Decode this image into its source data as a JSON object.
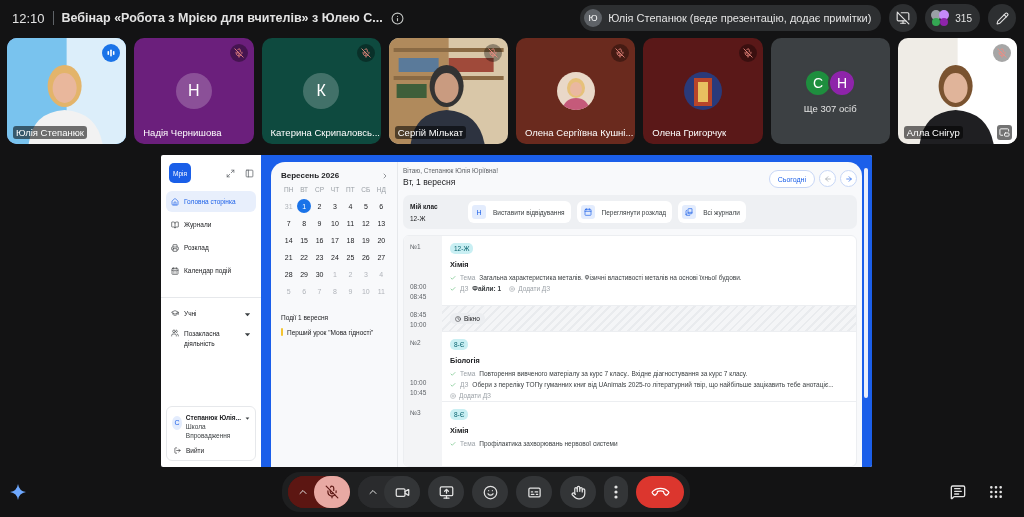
{
  "meeting": {
    "time": "12:10",
    "title": "Вебінар «Робота з Мрією для вчителів» з Юлею С..."
  },
  "presenter": {
    "initial": "Ю",
    "label": "Юлія Степанюк (веде презентацію, додає примітки)"
  },
  "participant_count": "315",
  "tiles": [
    {
      "kind": "video",
      "name": "Юлія Степанюк",
      "muted": false,
      "speaking": true
    },
    {
      "kind": "initial",
      "name": "Надія Чернишова",
      "initial": "Н",
      "muted": true,
      "speaking": false,
      "color": "#6b1f7c"
    },
    {
      "kind": "initial",
      "name": "Катерина Скрипаловсь...",
      "initial": "К",
      "muted": true,
      "speaking": false,
      "color": "#0e4a3f"
    },
    {
      "kind": "video",
      "name": "Сергій Мількат",
      "muted": true,
      "speaking": false
    },
    {
      "name": "Олена Сергіївна Кушні...",
      "muted": true,
      "speaking": false,
      "color": "#6a2a1e"
    },
    {
      "name": "Олена Григорчук",
      "muted": true,
      "speaking": false,
      "color": "#5a1818"
    },
    {
      "kind": "more",
      "label": "Ще 307 осіб",
      "initials": [
        {
          "letter": "С",
          "color": "#1e8e3e"
        },
        {
          "letter": "Н",
          "color": "#8e24aa"
        }
      ]
    },
    {
      "kind": "video",
      "name": "Алла Снігур",
      "muted": true,
      "speaking": false
    }
  ],
  "app": {
    "logo": "Мрія",
    "nav": [
      {
        "kind": "home",
        "label": "Головна сторінка",
        "selected": true
      },
      {
        "kind": "journal",
        "label": "Журнали",
        "selected": false
      },
      {
        "kind": "schedule",
        "label": "Розклад",
        "selected": false
      },
      {
        "kind": "calendar",
        "label": "Календар подій",
        "selected": false
      }
    ],
    "groups": [
      {
        "kind": "students",
        "label": "Учні",
        "expanded": false
      },
      {
        "kind": "extra",
        "label": "Позакласна діяльність",
        "expanded": false
      }
    ],
    "user": {
      "initial": "С",
      "name": "Степанюк Юлія...",
      "school": "Школа Впровадження",
      "logout": "Вийти"
    },
    "calendar": {
      "month": "Вересень 2026",
      "weekdays": [
        "ПН",
        "ВТ",
        "СР",
        "ЧТ",
        "ПТ",
        "СБ",
        "НД"
      ],
      "days": [
        {
          "d": "31",
          "outside": true,
          "selected": false
        },
        {
          "d": "1",
          "outside": false,
          "selected": true
        },
        {
          "d": "2",
          "outside": false,
          "selected": false
        },
        {
          "d": "3",
          "outside": false,
          "selected": false
        },
        {
          "d": "4",
          "outside": false,
          "selected": false
        },
        {
          "d": "5",
          "outside": false,
          "selected": false
        },
        {
          "d": "6",
          "outside": false,
          "selected": false
        },
        {
          "d": "7",
          "outside": false,
          "selected": false
        },
        {
          "d": "8",
          "outside": false,
          "selected": false
        },
        {
          "d": "9",
          "outside": false,
          "selected": false
        },
        {
          "d": "10",
          "outside": false,
          "selected": false
        },
        {
          "d": "11",
          "outside": false,
          "selected": false
        },
        {
          "d": "12",
          "outside": false,
          "selected": false
        },
        {
          "d": "13",
          "outside": false,
          "selected": false
        },
        {
          "d": "14",
          "outside": false,
          "selected": false
        },
        {
          "d": "15",
          "outside": false,
          "selected": false
        },
        {
          "d": "16",
          "outside": false,
          "selected": false
        },
        {
          "d": "17",
          "outside": false,
          "selected": false
        },
        {
          "d": "18",
          "outside": false,
          "selected": false
        },
        {
          "d": "19",
          "outside": false,
          "selected": false
        },
        {
          "d": "20",
          "outside": false,
          "selected": false
        },
        {
          "d": "21",
          "outside": false,
          "selected": false
        },
        {
          "d": "22",
          "outside": false,
          "selected": false
        },
        {
          "d": "23",
          "outside": false,
          "selected": false
        },
        {
          "d": "24",
          "outside": false,
          "selected": false
        },
        {
          "d": "25",
          "outside": false,
          "selected": false
        },
        {
          "d": "26",
          "outside": false,
          "selected": false
        },
        {
          "d": "27",
          "outside": false,
          "selected": false
        },
        {
          "d": "28",
          "outside": false,
          "selected": false
        },
        {
          "d": "29",
          "outside": false,
          "selected": false
        },
        {
          "d": "30",
          "outside": false,
          "selected": false
        },
        {
          "d": "1",
          "outside": true,
          "selected": false
        },
        {
          "d": "2",
          "outside": true,
          "selected": false
        },
        {
          "d": "3",
          "outside": true,
          "selected": false
        },
        {
          "d": "4",
          "outside": true,
          "selected": false
        },
        {
          "d": "5",
          "outside": true,
          "selected": false
        },
        {
          "d": "6",
          "outside": true,
          "selected": false
        },
        {
          "d": "7",
          "outside": true,
          "selected": false
        },
        {
          "d": "8",
          "outside": true,
          "selected": false
        },
        {
          "d": "9",
          "outside": true,
          "selected": false
        },
        {
          "d": "10",
          "outside": true,
          "selected": false
        },
        {
          "d": "11",
          "outside": true,
          "selected": false
        }
      ],
      "events_title": "Події 1 вересня",
      "events": [
        {
          "label": "Перший урок \"Мова гідності\"",
          "color": "#f4c430"
        }
      ]
    },
    "greeting": "Вітаю, Степанюк Юлія Юріївна!",
    "date": "Вт, 1 вересня",
    "today_button": "Сьогодні",
    "class_card": {
      "label": "Мій клас",
      "value": "12-Ж",
      "actions": [
        {
          "kind": "attendance",
          "badge": "Н",
          "label": "Виставити відвідування"
        },
        {
          "kind": "schedule",
          "label": "Переглянути розклад"
        },
        {
          "kind": "journals",
          "label": "Всі журнали"
        }
      ]
    },
    "lessons": [
      {
        "kind": "lesson",
        "number": "№1",
        "start": "08:00",
        "end": "08:45",
        "group": "12-Ж",
        "subject": "Хімія",
        "rows": [
          {
            "kind": "topic",
            "label": "Тема",
            "text": "Загальна характеристика металів. Фізичні властивості металів на основі їхньої будови."
          },
          {
            "kind": "homework",
            "label": "ДЗ",
            "text": "Файли: 1",
            "add": "Додати ДЗ"
          }
        ]
      },
      {
        "kind": "break",
        "start": "08:45",
        "end": "10:00",
        "label": "Вікно"
      },
      {
        "kind": "lesson",
        "number": "№2",
        "start": "10:00",
        "end": "10:45",
        "group": "8-Є",
        "subject": "Біологія",
        "rows": [
          {
            "kind": "topic",
            "label": "Тема",
            "text": "Повторення вивченого матеріалу за курс 7 класу.. Вхідне діагностування за курс 7 класу."
          },
          {
            "kind": "homework",
            "label": "ДЗ",
            "text": "Обери з переліку ТОПу гуманних книг від UAnimals 2025-го літературний твір, що найбільше зацікавить тебе анотаціє..."
          },
          {
            "kind": "add",
            "text": "Додати ДЗ"
          }
        ]
      },
      {
        "kind": "lesson",
        "number": "№3",
        "group": "8-Є",
        "subject": "Хімія",
        "rows": [
          {
            "kind": "topic",
            "label": "Тема",
            "text": "Профілактика захворювань нервової системи"
          }
        ]
      }
    ]
  }
}
